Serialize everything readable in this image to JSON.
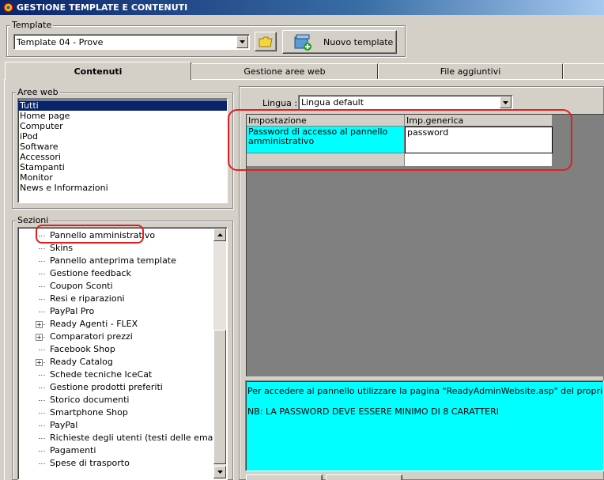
{
  "window": {
    "title": "GESTIONE TEMPLATE E CONTENUTI",
    "icon": "app-icon"
  },
  "template_group": {
    "label": "Template",
    "selected": "Template 04 - Prove",
    "open_icon": "folder-icon",
    "new_button_label": "Nuovo template",
    "new_button_icon": "new-template-icon"
  },
  "tabs": [
    {
      "label": "Contenuti",
      "active": true
    },
    {
      "label": "Gestione aree web",
      "active": false
    },
    {
      "label": "File aggiuntivi",
      "active": false
    }
  ],
  "aree_web": {
    "label": "Aree web",
    "items": [
      "Tutti",
      "Home page",
      "Computer",
      "iPod",
      "Software",
      "Accessori",
      "Stampanti",
      "Monitor",
      "News e Informazioni"
    ],
    "selected_index": 0
  },
  "sezioni": {
    "label": "Sezioni",
    "items": [
      {
        "label": "Pannello amministrativo",
        "expandable": false
      },
      {
        "label": "Skins",
        "expandable": false
      },
      {
        "label": "Pannello anteprima template",
        "expandable": false
      },
      {
        "label": "Gestione feedback",
        "expandable": false
      },
      {
        "label": "Coupon Sconti",
        "expandable": false
      },
      {
        "label": "Resi e riparazioni",
        "expandable": false
      },
      {
        "label": "PayPal Pro",
        "expandable": false
      },
      {
        "label": "Ready Agenti - FLEX",
        "expandable": true
      },
      {
        "label": "Comparatori prezzi",
        "expandable": true
      },
      {
        "label": "Facebook Shop",
        "expandable": false
      },
      {
        "label": "Ready Catalog",
        "expandable": true
      },
      {
        "label": "Schede tecniche IceCat",
        "expandable": false
      },
      {
        "label": "Gestione prodotti preferiti",
        "expandable": false
      },
      {
        "label": "Storico documenti",
        "expandable": false
      },
      {
        "label": "Smartphone Shop",
        "expandable": false
      },
      {
        "label": "PayPal",
        "expandable": false
      },
      {
        "label": "Richieste degli utenti (testi delle email)",
        "expandable": false
      },
      {
        "label": "Pagamenti",
        "expandable": false
      },
      {
        "label": "Spese di trasporto",
        "expandable": false
      }
    ]
  },
  "lingua": {
    "label": "Lingua :",
    "selected": "Lingua default"
  },
  "grid": {
    "columns": [
      "Impostazione",
      "Imp.generica"
    ],
    "rows": [
      [
        "Password di accesso al pannello amministrativo",
        "password"
      ],
      [
        "",
        ""
      ]
    ]
  },
  "description": {
    "line1": "Per accedere al pannello utilizzare la pagina \"ReadyAdminWebsite.asp\" del proprio sito. ES: w",
    "line2": "NB: LA PASSWORD DEVE ESSERE MINIMO DI 8 CARATTERI"
  },
  "colors": {
    "highlight": "#00ffff",
    "annotation": "#e02020",
    "selection": "#0a246a",
    "grid_bg": "#808080"
  }
}
